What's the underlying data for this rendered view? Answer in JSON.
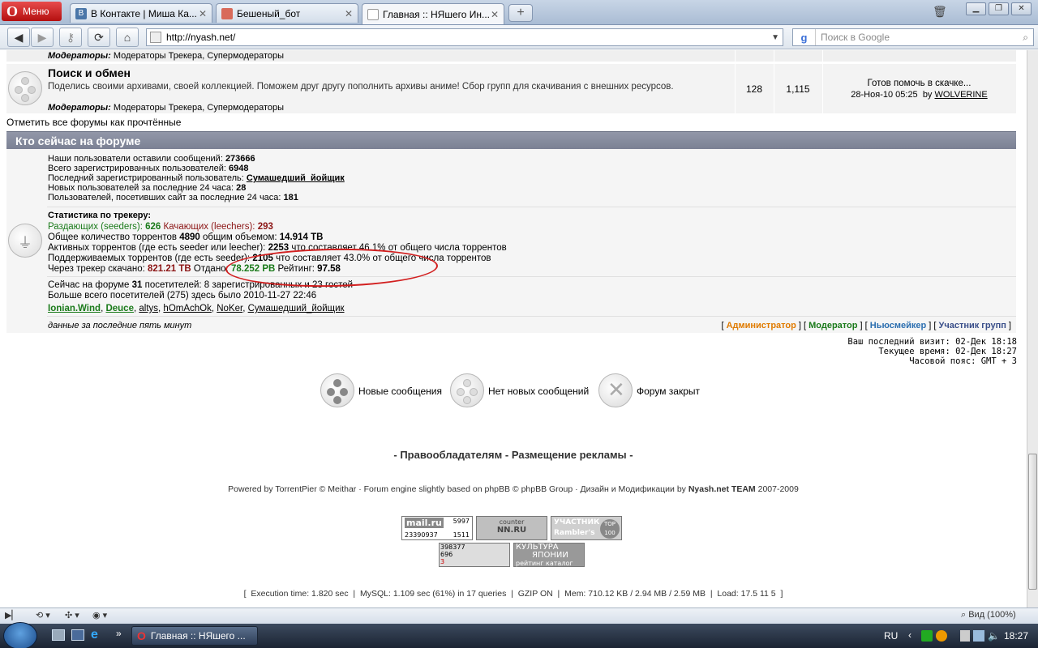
{
  "browser": {
    "menu_label": "Меню",
    "tabs": [
      {
        "title": "В Контакте | Миша Ка...",
        "fav_color": "#4a76a8"
      },
      {
        "title": "Бешеный_бот",
        "fav_color": "#c94040"
      },
      {
        "title": "Главная :: НЯшего Ин...",
        "fav_color": "#ffffff"
      }
    ],
    "url": "http://nyash.net/",
    "search_placeholder": "Поиск в Google",
    "zoom_label": "Вид (100%)"
  },
  "forums": {
    "top_mods_label": "Модераторы:",
    "top_mods": "Модераторы Трекера, Супермодераторы",
    "row": {
      "title": "Поиск и обмен",
      "description": "Поделись своими архивами, своей коллекцией. Поможем друг другу пополнить архивы аниме! Сбор групп для скачивания с внешних ресурсов.",
      "mods_label": "Модераторы:",
      "mods": "Модераторы Трекера, Супермодераторы",
      "topics": "128",
      "posts": "1,115",
      "last_title": "Готов помочь в скачке...",
      "last_date": "28-Ноя-10 05:25",
      "last_by": "by",
      "last_user": "WOLVERINE"
    },
    "mark_read": "Отметить все форумы как прочтённые"
  },
  "who": {
    "header": "Кто сейчас на форуме",
    "stats": [
      {
        "label": "Наши пользователи оставили сообщений:",
        "value": "273666"
      },
      {
        "label": "Всего зарегистрированных пользователей:",
        "value": "6948"
      },
      {
        "label": "Последний зарегистрированный пользователь:",
        "value": "Сумашедший_йойщик"
      },
      {
        "label": "Новых пользователей за последние 24 часа:",
        "value": "28"
      },
      {
        "label": "Пользователей, посетивших сайт за последние 24 часа:",
        "value": "181"
      }
    ],
    "tracker_title": "Статистика по трекеру:",
    "seeders_label": "Раздающих (seeders):",
    "seeders": "626",
    "leechers_label": "Качающих (leechers):",
    "leechers": "293",
    "total_label": "Общее количество торрентов",
    "total": "4890",
    "volume_label": "общим объемом:",
    "volume": "14.914 TB",
    "active_label": "Активных торрентов (где есть seeder или leecher):",
    "active": "2253",
    "active_pct": "что составляет 46.1% от общего числа торрентов",
    "kept_label": "Поддерживаемых торрентов (где есть seeder):",
    "kept": "2105",
    "kept_pct": "что составляет 43.0% от общего числа торрентов",
    "down_label": "Через трекер скачано:",
    "down": "821.21 TB",
    "up_label": "Отдано:",
    "up": "78.252 PB",
    "rating_label": "Рейтинг:",
    "rating": "97.58",
    "online_text_1": "Сейчас на форуме",
    "online_count": "31",
    "online_text_2": "посетителей: 8 зарегистрированных и 23 гостей",
    "record_text": "Больше всего посетителей (275) здесь было 2010-11-27 22:46",
    "online_users": [
      "Ionian.Wind",
      "Deuce",
      "altys",
      "hOmAchOk",
      "NoKer",
      "Сумашедший_йойщик"
    ],
    "last_five": "данные за последние пять минут",
    "legend": [
      {
        "label": "Администратор",
        "color": "#e07b00"
      },
      {
        "label": "Модератор",
        "color": "#1a7a1a"
      },
      {
        "label": "Ньюсмейкер",
        "color": "#2c6fb0"
      },
      {
        "label": "Участник групп",
        "color": "#3a4f8a"
      }
    ]
  },
  "times": {
    "last_visit": "Ваш последний визит: 02-Дек 18:18",
    "now": "Текущее время: 02-Дек 18:27",
    "tz": "Часовой пояс: GMT + 3"
  },
  "legend_icons": {
    "new": "Новые сообщения",
    "no_new": "Нет новых сообщений",
    "closed": "Форум закрыт"
  },
  "footer": {
    "links_prefix": "-",
    "link1": "Правообладателям",
    "link2": "Размещение рекламы",
    "powered": "Powered by",
    "tp": "TorrentPier",
    "copy": "© Meithar · Forum engine slightly based on phpBB © phpBB Group · Дизайн и Модификации by",
    "team": "Nyash.net TEAM",
    "years": "2007-2009",
    "exec": "[  Execution time: 1.820 sec  |  MySQL: 1.109 sec (61%) in 17 queries  |  GZIP ON  |  Mem: 710.12 KB / 2.94 MB / 2.59 MB  |  Load: 17.5 11 5  ]"
  },
  "counters": {
    "mail_top": "5997",
    "mail_num": "23390937",
    "mail_bot": "1511",
    "nn_top": "counter",
    "nn_bot": "NN.RU",
    "rambler_1": "УЧАСТНИК",
    "rambler_2": "Rambler's",
    "rambler_3": "TOP 100",
    "li_1": "398377",
    "li_2": "696",
    "li_3": "3",
    "japan_1": "КУЛЬТУРА",
    "japan_2": "ЯПОНИИ",
    "japan_3": "рейтинг каталог"
  },
  "taskbar": {
    "task": "Главная :: НЯшего ...",
    "lang": "RU",
    "clock": "18:27"
  }
}
